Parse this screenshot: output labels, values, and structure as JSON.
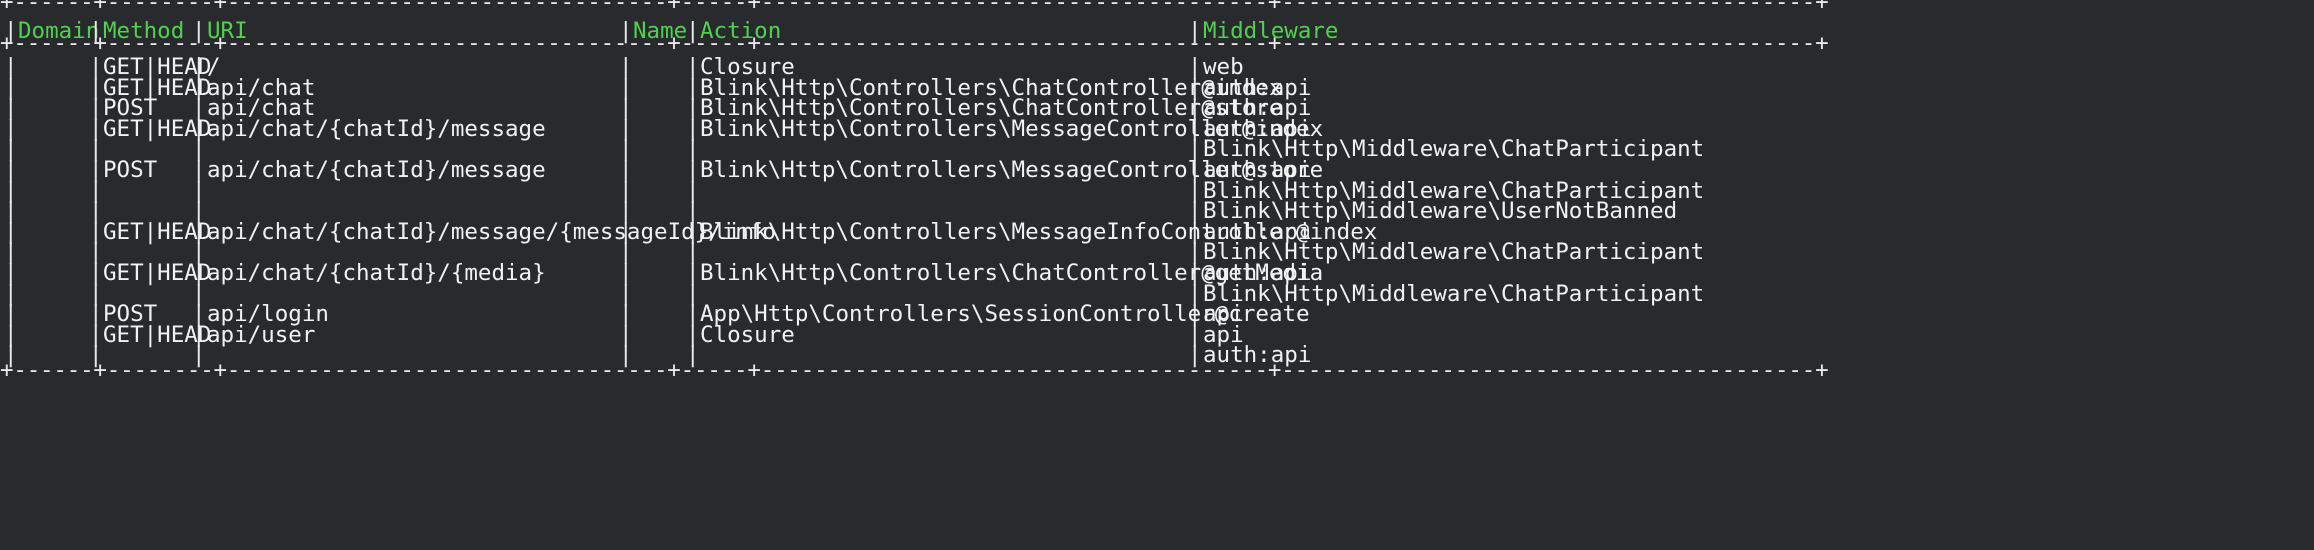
{
  "header": {
    "domain": "Domain",
    "method": "Method",
    "uri": "URI",
    "name": "Name",
    "action": "Action",
    "middleware": "Middleware"
  },
  "rows": [
    {
      "domain": "",
      "method": "GET|HEAD",
      "uri": "/",
      "name": "",
      "action": "Closure",
      "middleware": "web"
    },
    {
      "domain": "",
      "method": "GET|HEAD",
      "uri": "api/chat",
      "name": "",
      "action": "Blink\\Http\\Controllers\\ChatController@index",
      "middleware": "auth:api"
    },
    {
      "domain": "",
      "method": "POST",
      "uri": "api/chat",
      "name": "",
      "action": "Blink\\Http\\Controllers\\ChatController@store",
      "middleware": "auth:api"
    },
    {
      "domain": "",
      "method": "GET|HEAD",
      "uri": "api/chat/{chatId}/message",
      "name": "",
      "action": "Blink\\Http\\Controllers\\MessageController@index",
      "middleware": "auth:api"
    },
    {
      "domain": "",
      "method": "",
      "uri": "",
      "name": "",
      "action": "",
      "middleware": "Blink\\Http\\Middleware\\ChatParticipant"
    },
    {
      "domain": "",
      "method": "POST",
      "uri": "api/chat/{chatId}/message",
      "name": "",
      "action": "Blink\\Http\\Controllers\\MessageController@store",
      "middleware": "auth:api"
    },
    {
      "domain": "",
      "method": "",
      "uri": "",
      "name": "",
      "action": "",
      "middleware": "Blink\\Http\\Middleware\\ChatParticipant"
    },
    {
      "domain": "",
      "method": "",
      "uri": "",
      "name": "",
      "action": "",
      "middleware": "Blink\\Http\\Middleware\\UserNotBanned"
    },
    {
      "domain": "",
      "method": "GET|HEAD",
      "uri": "api/chat/{chatId}/message/{messageId}/info",
      "name": "",
      "action": "Blink\\Http\\Controllers\\MessageInfoController@index",
      "middleware": "auth:api"
    },
    {
      "domain": "",
      "method": "",
      "uri": "",
      "name": "",
      "action": "",
      "middleware": "Blink\\Http\\Middleware\\ChatParticipant"
    },
    {
      "domain": "",
      "method": "GET|HEAD",
      "uri": "api/chat/{chatId}/{media}",
      "name": "",
      "action": "Blink\\Http\\Controllers\\ChatController@getMedia",
      "middleware": "auth:api"
    },
    {
      "domain": "",
      "method": "",
      "uri": "",
      "name": "",
      "action": "",
      "middleware": "Blink\\Http\\Middleware\\ChatParticipant"
    },
    {
      "domain": "",
      "method": "POST",
      "uri": "api/login",
      "name": "",
      "action": "App\\Http\\Controllers\\SessionController@create",
      "middleware": "api"
    },
    {
      "domain": "",
      "method": "GET|HEAD",
      "uri": "api/user",
      "name": "",
      "action": "Closure",
      "middleware": "api"
    },
    {
      "domain": "",
      "method": "",
      "uri": "",
      "name": "",
      "action": "",
      "middleware": "auth:api"
    }
  ],
  "colors": {
    "background": "#282a2e",
    "header_text": "#4fd34c",
    "body_text": "#f2f2f2"
  }
}
